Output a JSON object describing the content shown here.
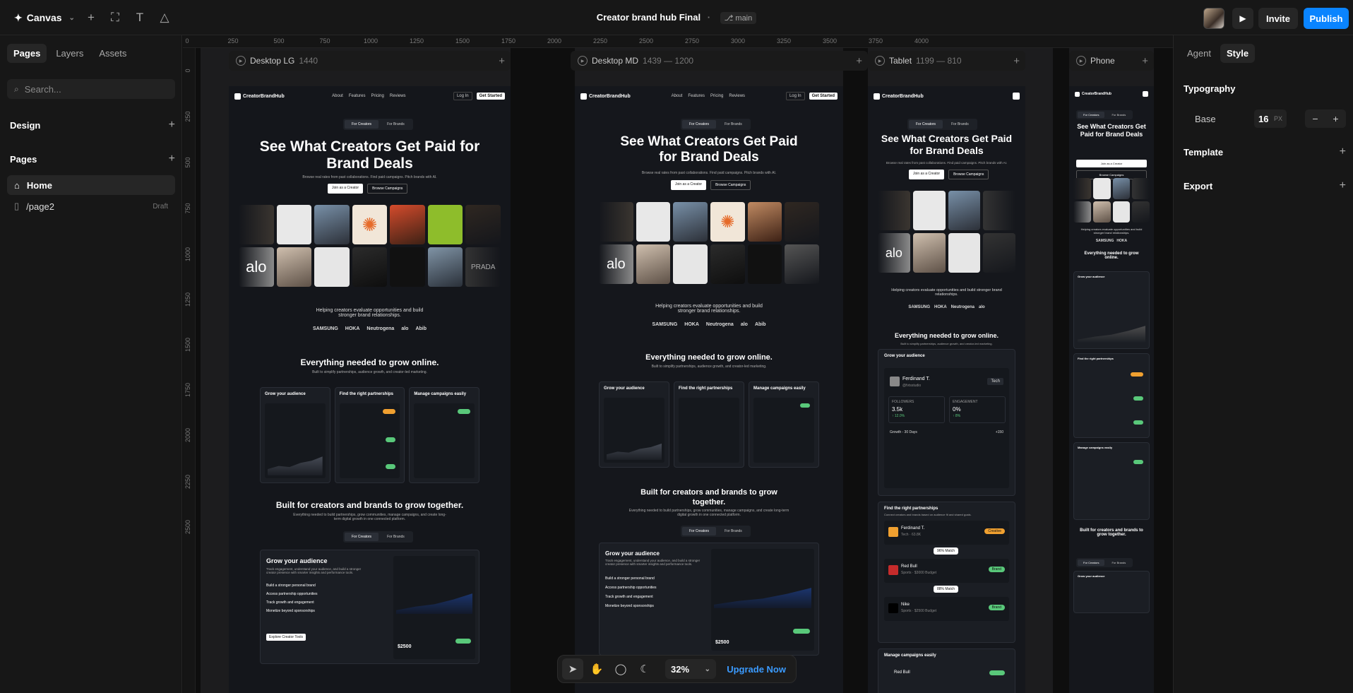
{
  "app": {
    "name": "Canvas"
  },
  "project": {
    "title": "Creator brand hub Final",
    "separator": "·",
    "branch": "main"
  },
  "header": {
    "invite_label": "Invite",
    "publish_label": "Publish"
  },
  "left_panel": {
    "tabs": [
      "Pages",
      "Layers",
      "Assets"
    ],
    "search_placeholder": "Search...",
    "design_label": "Design",
    "pages_label": "Pages",
    "pages": [
      {
        "label": "Home",
        "status": ""
      },
      {
        "label": "/page2",
        "status": "Draft"
      }
    ]
  },
  "right_panel": {
    "tabs": [
      "Agent",
      "Style"
    ],
    "typography_label": "Typography",
    "base_label": "Base",
    "base_value": "16",
    "base_unit": "PX",
    "template_label": "Template",
    "export_label": "Export"
  },
  "ruler": {
    "h": [
      "0",
      "250",
      "500",
      "750",
      "1000",
      "1250",
      "1500",
      "1750",
      "2000",
      "2250",
      "2500",
      "2750",
      "3000",
      "3250",
      "3500",
      "3750",
      "4000"
    ],
    "v": [
      "0",
      "250",
      "500",
      "750",
      "1000",
      "1250",
      "1500",
      "1750",
      "2000",
      "2250",
      "2500"
    ]
  },
  "frames": [
    {
      "name": "Desktop LG",
      "dims": "1440"
    },
    {
      "name": "Desktop MD",
      "dims": "1439 — 1200"
    },
    {
      "name": "Tablet",
      "dims": "1199 — 810"
    },
    {
      "name": "Phone",
      "dims": ""
    }
  ],
  "site": {
    "brand": "CreatorBrandHub",
    "nav_links": [
      "About",
      "Features",
      "Pricing",
      "Reviews"
    ],
    "login": "Log In",
    "get_started": "Get Started",
    "tab_creators": "For Creators",
    "tab_brands": "For Brands",
    "hero_title": "See What Creators Get Paid for Brand Deals",
    "hero_sub": "Browse real rates from past collaborations. Find paid campaigns. Pitch brands with AI.",
    "cta_primary": "Join as a Creator",
    "cta_secondary": "Browse Campaigns",
    "helping": "Helping creators evaluate opportunities and build stronger brand relationships.",
    "logos": [
      "SAMSUNG",
      "HOKA",
      "Neutrogena",
      "alo",
      "Abib"
    ],
    "everything_title": "Everything needed to grow online.",
    "everything_sub": "Built to simplify partnerships, audience growth, and creator-led marketing.",
    "card_titles": [
      "Grow your audience",
      "Find the right partnerships",
      "Manage campaigns easily"
    ],
    "built_title": "Built for creators and brands to grow together.",
    "built_sub": "Everything needed to build partnerships, grow communities, manage campaigns, and create long-term digital growth in one connected platform.",
    "big_card_title": "Grow your audience",
    "big_card_sub": "Track engagement, understand your audience, and build a stronger creator presence with smarter insights and performance tools.",
    "big_items": [
      "Build a stronger personal brand",
      "Access partnership opportunities",
      "Track growth and engagement",
      "Monetize beyond sponsorships"
    ],
    "explore_btn": "Explore Creator Tools",
    "amount": "$2500",
    "tablet_card": {
      "creator": "Ferdinand T.",
      "creator_handle": "@fvtsstudio",
      "niche": "Tech",
      "followers_label": "FOLLOWERS",
      "followers": "3.5k",
      "followers_delta": "12.0%",
      "engagement_label": "ENGAGEMENT",
      "engagement": "0%",
      "engagement_delta": "8%",
      "growth_label": "Growth - 30 Days",
      "growth_value": "+150"
    },
    "tablet_partners": {
      "title": "Find the right partnerships",
      "sub": "Connect creators and brands based on audience fit and shared goals.",
      "p1_name": "Ferdinand T.",
      "p1_meta": "Tech · 63.8K",
      "p1_tag": "Creative",
      "match1": "96% Match",
      "p2_name": "Red Bull",
      "p2_meta": "Sports · $3000 Budget",
      "p2_tag": "Brand",
      "match2": "88% Match",
      "p3_name": "Nike",
      "p3_meta": "Sports · $2500 Budget",
      "p3_tag": "Brand"
    },
    "tablet_manage": "Manage campaigns easily",
    "tablet_manage_item": "Red Bull"
  },
  "bottom_bar": {
    "zoom": "32%",
    "upgrade": "Upgrade Now"
  },
  "colors": {
    "accent": "#0a84ff",
    "bg": "#111111",
    "panel": "#171717",
    "site_bg": "#14161b",
    "tag_orange": "#f0a030",
    "tag_green": "#59c87a"
  }
}
